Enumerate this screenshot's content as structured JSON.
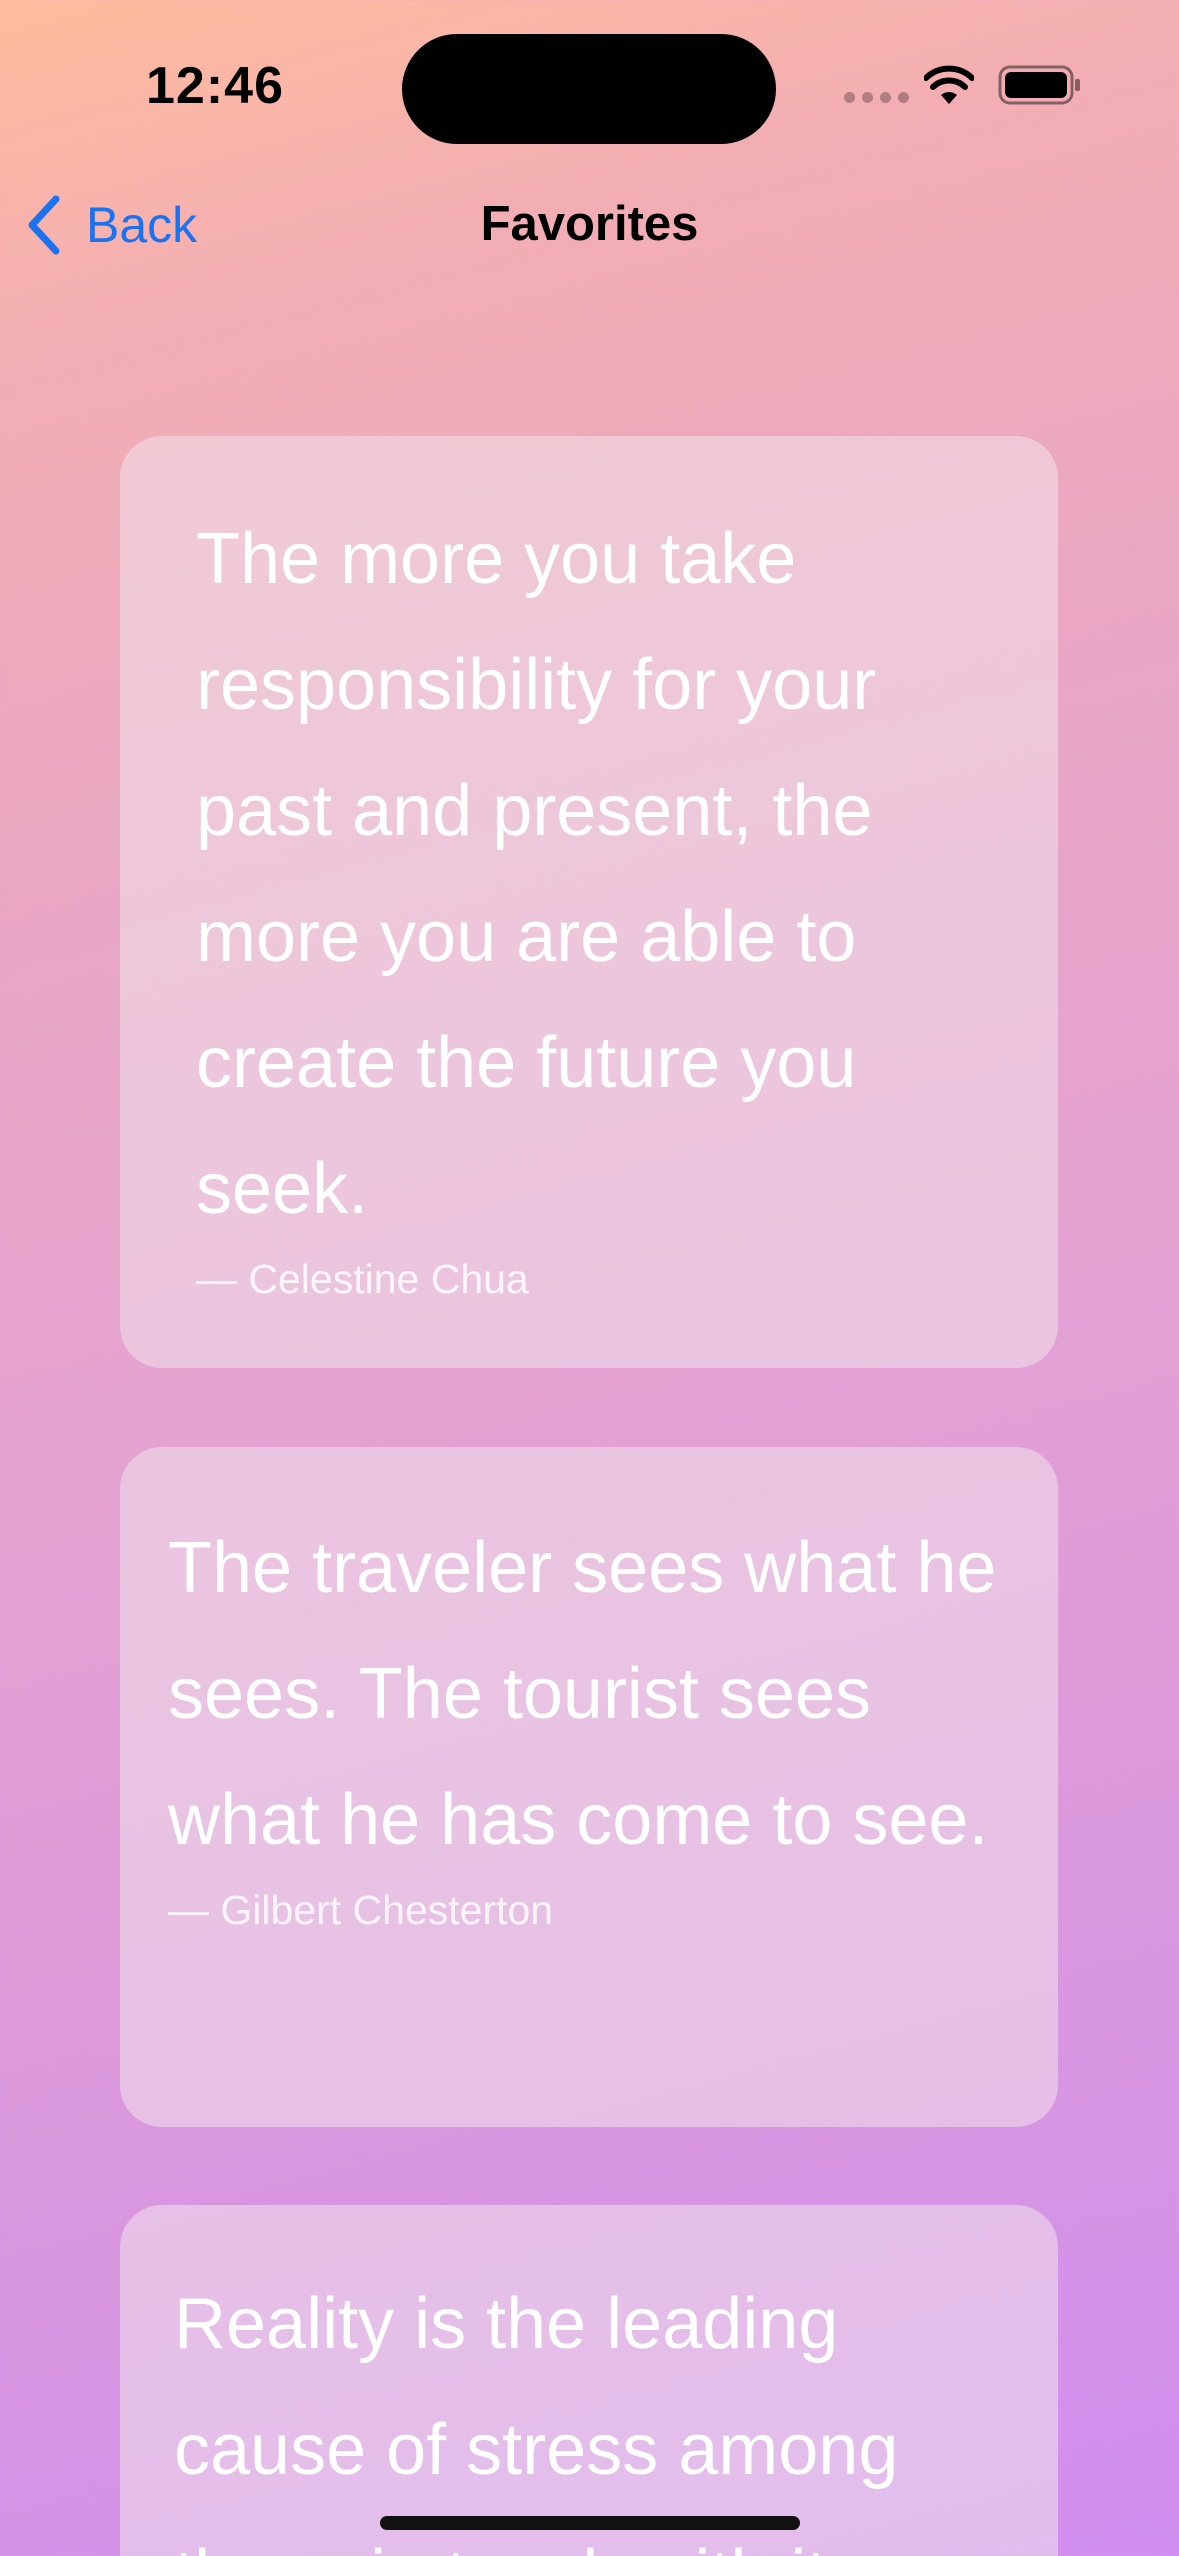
{
  "status_bar": {
    "time": "12:46"
  },
  "nav": {
    "back_label": "Back",
    "title": "Favorites"
  },
  "quotes": [
    {
      "text": "The more you take responsibility for your past and present, the more you are able to create the future you seek.",
      "author": "— Celestine Chua"
    },
    {
      "text": "The traveler sees what he sees. The tourist sees what he has come to see.",
      "author": "— Gilbert Chesterton"
    },
    {
      "text": "Reality is the leading cause of stress among those in touch with it.",
      "author": ""
    }
  ],
  "colors": {
    "accent": "#1a72f0",
    "background_top": "#ffbc9c",
    "background_bottom": "#d08ff0"
  }
}
